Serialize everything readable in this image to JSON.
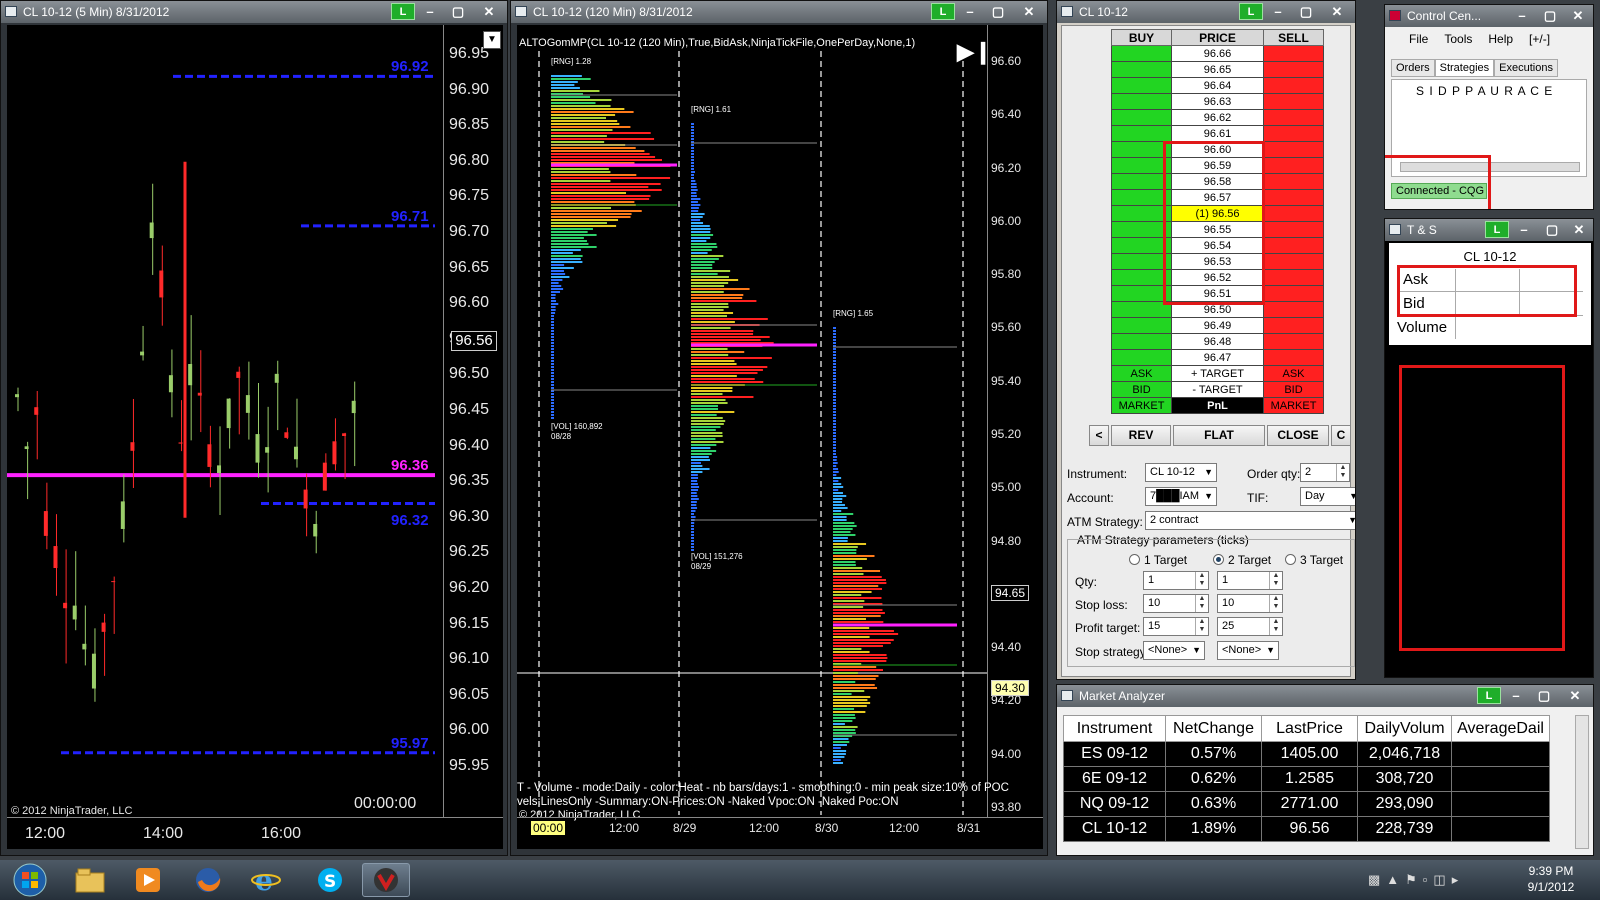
{
  "chart1": {
    "title": "CL 10-12 (5 Min)  8/31/2012",
    "link": "L",
    "price_ticks": [
      "96.95",
      "96.90",
      "96.85",
      "96.80",
      "96.75",
      "96.70",
      "96.65",
      "96.60",
      "96.55",
      "96.50",
      "96.45",
      "96.40",
      "96.35",
      "96.30",
      "96.25",
      "96.20",
      "96.15",
      "96.10",
      "96.05",
      "96.00",
      "95.95"
    ],
    "time_ticks": [
      "12:00",
      "14:00",
      "16:00"
    ],
    "levels": [
      {
        "label": "96.92",
        "color": "#2222ff"
      },
      {
        "label": "96.71",
        "color": "#2222ff"
      },
      {
        "label": "96.36",
        "color": "#ff22ff"
      },
      {
        "label": "96.32",
        "color": "#2222ff"
      },
      {
        "label": "95.97",
        "color": "#2222ff"
      }
    ],
    "current_price": "96.56",
    "countdown": "00:00:00",
    "copyright": "© 2012 NinjaTrader, LLC",
    "price_range": [
      95.95,
      96.95
    ]
  },
  "chart2": {
    "title": "CL 10-12 (120 Min)  8/31/2012",
    "link": "L",
    "indicator": "ALTOGomMP(CL 10-12 (120 Min),True,BidAsk,NinjaTickFile,OnePerDay,None,1)",
    "price_ticks": [
      "96.60",
      "96.40",
      "96.20",
      "96.00",
      "95.80",
      "95.60",
      "95.40",
      "95.20",
      "95.00",
      "94.80",
      "94.60",
      "94.40",
      "94.20",
      "94.00",
      "93.80"
    ],
    "time_ticks": [
      "00:00",
      "12:00",
      "8/29",
      "12:00",
      "8/30",
      "12:00",
      "8/31"
    ],
    "profiles": [
      {
        "rng": "[RNG] 1.28",
        "vol": "[VOL] 160,892",
        "date": "08/28"
      },
      {
        "rng": "[RNG] 1.61",
        "vol": "[VOL] 151,276",
        "date": "08/29"
      },
      {
        "rng": "[RNG] 1.65",
        "vol": "",
        "date": ""
      }
    ],
    "last_price_tag": "94.65",
    "line_price_tag": "94.30",
    "footer_line1": "T - Volume - mode:Daily  - color:Heat - nb bars/days:1 - smoothing:0 - min peak size:10% of POC",
    "footer_line2": "vels:LinesOnly -Summary:ON-Prices:ON -Naked Vpoc:ON -Naked Poc:ON",
    "copyright": "© 2012 NinjaTrader, LLC"
  },
  "dom": {
    "title": "CL 10-12",
    "link": "L",
    "headers": {
      "buy": "BUY",
      "price": "PRICE",
      "sell": "SELL"
    },
    "prices": [
      "96.66",
      "96.65",
      "96.64",
      "96.63",
      "96.62",
      "96.61",
      "96.60",
      "96.59",
      "96.58",
      "96.57",
      "(1) 96.56",
      "96.55",
      "96.54",
      "96.53",
      "96.52",
      "96.51",
      "96.50",
      "96.49",
      "96.48",
      "96.47"
    ],
    "current_index": 10,
    "ask_row": {
      "buy": "ASK",
      "price": "+ TARGET",
      "sell": "ASK"
    },
    "bid_row": {
      "buy": "BID",
      "price": "- TARGET",
      "sell": "BID"
    },
    "market_row": {
      "buy": "MARKET",
      "price": "PnL",
      "sell": "MARKET"
    },
    "buttons": {
      "left": "<",
      "rev": "REV",
      "flat": "FLAT",
      "close": "CLOSE",
      "c": "C"
    },
    "instrument_label": "Instrument:",
    "instrument": "CL 10-12",
    "orderqty_label": "Order qty:",
    "orderqty": "2",
    "account_label": "Account:",
    "account": "7███IAM",
    "tif_label": "TIF:",
    "tif": "Day",
    "atm_label": "ATM Strategy:",
    "atm": "2 contract",
    "params_label": "ATM Strategy parameters (ticks)",
    "targets": [
      "1 Target",
      "2 Target",
      "3 Target"
    ],
    "qty_label": "Qty:",
    "qty": [
      "1",
      "1"
    ],
    "stoploss_label": "Stop loss:",
    "stoploss": [
      "10",
      "10"
    ],
    "profit_label": "Profit target:",
    "profit": [
      "15",
      "25"
    ],
    "stopstrat_label": "Stop strategy:",
    "stopstrat": [
      "<None>",
      "<None>"
    ]
  },
  "control_center": {
    "title": "Control Cen...",
    "menu": [
      "File",
      "Tools",
      "Help",
      "[+/-]"
    ],
    "tabs": [
      "Orders",
      "Strategies",
      "Executions"
    ],
    "columns": "S I D P P A U R A C E",
    "status": "Connected - CQG"
  },
  "ts": {
    "title": "T & S",
    "link": "L",
    "instrument": "CL 10-12",
    "rows": [
      "Ask",
      "Bid",
      "Volume"
    ]
  },
  "market_analyzer": {
    "title": "Market Analyzer",
    "link": "L",
    "columns": [
      "Instrument",
      "NetChange",
      "LastPrice",
      "DailyVolum",
      "AverageDail"
    ],
    "rows": [
      [
        "ES 09-12",
        "0.57%",
        "1405.00",
        "2,046,718",
        ""
      ],
      [
        "6E 09-12",
        "0.62%",
        "1.2585",
        "308,720",
        ""
      ],
      [
        "NQ 09-12",
        "0.63%",
        "2771.00",
        "293,090",
        ""
      ],
      [
        "CL 10-12",
        "1.89%",
        "96.56",
        "228,739",
        ""
      ]
    ]
  },
  "taskbar": {
    "clock_time": "9:39 PM",
    "clock_date": "9/1/2012"
  }
}
